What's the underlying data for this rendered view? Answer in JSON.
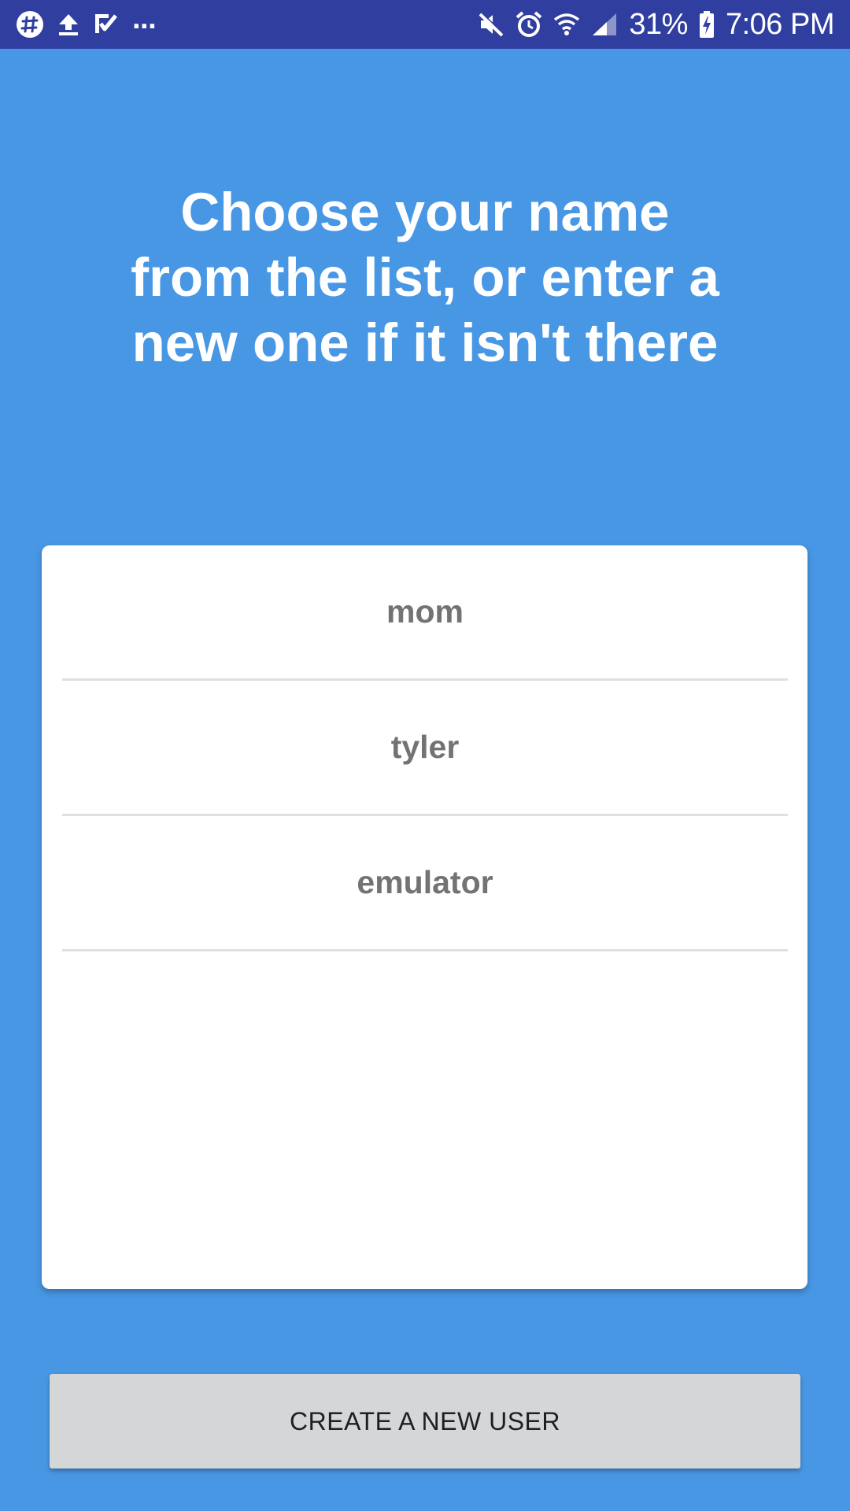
{
  "status_bar": {
    "left_icons": [
      "slack-icon",
      "upload-icon",
      "tasks-check-icon"
    ],
    "overflow": "...",
    "right_icons": [
      "mute-icon",
      "alarm-icon",
      "wifi-icon",
      "signal-icon",
      "battery-charging-icon"
    ],
    "battery": "31%",
    "time": "7:06 PM",
    "background_color": "#303f9f"
  },
  "headline": "Choose your name\nfrom the list, or enter a\nnew one if it isn't there",
  "users": [
    "mom",
    "tyler",
    "emulator"
  ],
  "create_button": {
    "label": "CREATE A NEW USER"
  },
  "colors": {
    "background": "#4897e4",
    "card": "#ffffff",
    "list_text": "#737373",
    "button": "#d5d6d7"
  }
}
